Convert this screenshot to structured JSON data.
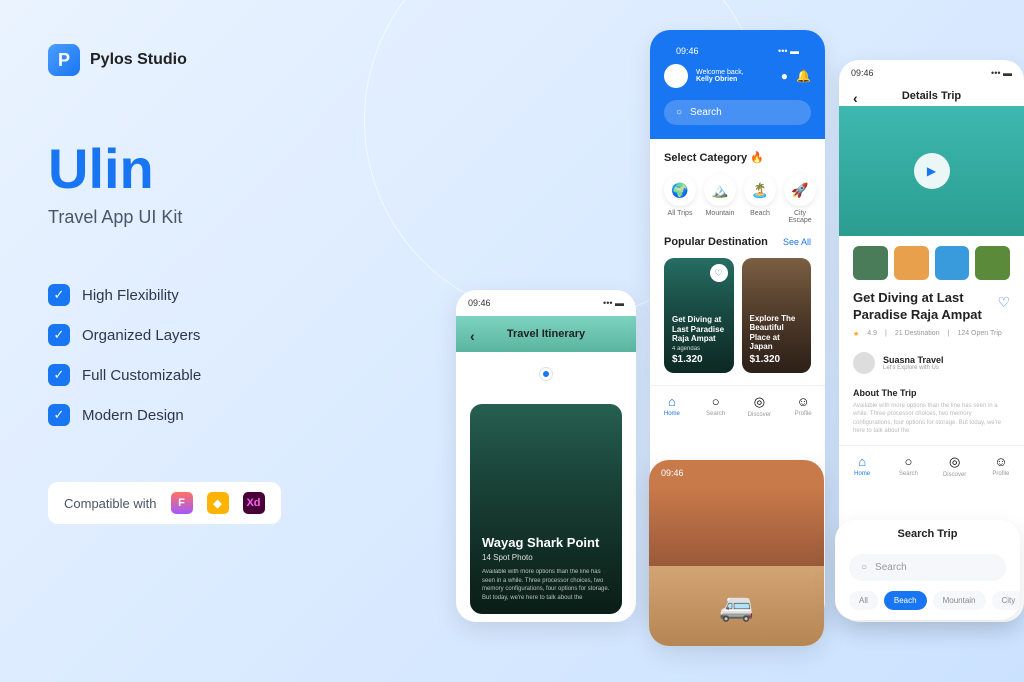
{
  "brand": {
    "name": "Pylos Studio"
  },
  "product": {
    "title": "Ulin",
    "subtitle": "Travel App UI Kit"
  },
  "features": [
    "High Flexibility",
    "Organized Layers",
    "Full Customizable",
    "Modern Design"
  ],
  "compat": {
    "label": "Compatible with",
    "tools": [
      "Figma",
      "Sketch",
      "Xd"
    ]
  },
  "home": {
    "time": "09:46",
    "welcome_label": "Welcome back,",
    "user_name": "Kelly Obrien",
    "search_placeholder": "Search",
    "category_title": "Select Category 🔥",
    "categories": [
      {
        "icon": "🌍",
        "label": "All Trips"
      },
      {
        "icon": "🏔️",
        "label": "Mountain"
      },
      {
        "icon": "🏝️",
        "label": "Beach"
      },
      {
        "icon": "🚀",
        "label": "City Escape"
      }
    ],
    "popular_title": "Popular Destination",
    "see_all": "See All",
    "cards": [
      {
        "title": "Get Diving at Last Paradise Raja Ampat",
        "sub": "4 agendas",
        "price": "$1.320"
      },
      {
        "title": "Explore The Beautiful Place at Japan",
        "sub": "",
        "price": "$1.320"
      }
    ],
    "nav": [
      {
        "icon": "⌂",
        "label": "Home"
      },
      {
        "icon": "○",
        "label": "Search"
      },
      {
        "icon": "◎",
        "label": "Discover"
      },
      {
        "icon": "☺",
        "label": "Profile"
      }
    ]
  },
  "details": {
    "time": "09:46",
    "header": "Details Trip",
    "title": "Get Diving at Last Paradise Raja Ampat",
    "rating": "4.9",
    "meta1": "21 Destination",
    "meta2": "124 Open Trip",
    "agent_name": "Suasna Travel",
    "agent_sub": "Let's Explore with Us",
    "about_title": "About The Trip",
    "about_text": "Available with more options than the line has seen in a while. Three processor choices, two memory configurations, four options for storage. But today, we're here to talk about the"
  },
  "itinerary": {
    "time": "09:46",
    "header": "Travel Itinerary",
    "card_title": "Wayag Shark Point",
    "card_sub": "14 Spot Photo",
    "card_desc": "Available with more options than the line has seen in a while. Three processor choices, two memory configurations, four options for storage. But today, we're here to talk about the"
  },
  "gallery": {
    "time": "09:46"
  },
  "search": {
    "header": "Search Trip",
    "placeholder": "Search",
    "filters": [
      "All",
      "Beach",
      "Mountain",
      "City"
    ]
  }
}
